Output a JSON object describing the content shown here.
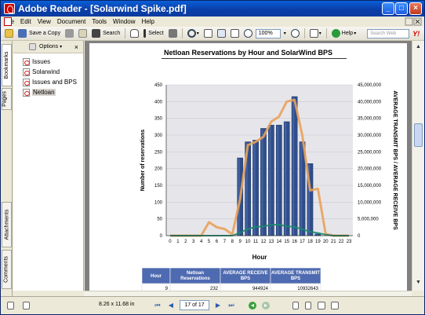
{
  "window": {
    "title": "Adobe Reader - [Solarwind Spike.pdf]",
    "controls": {
      "minimize": "_",
      "maximize": "□",
      "close": "×"
    },
    "accent": "#0a3fa8"
  },
  "menu": {
    "items": [
      "File",
      "Edit",
      "View",
      "Document",
      "Tools",
      "Window",
      "Help"
    ]
  },
  "toolbar": {
    "save_copy": "Save a Copy",
    "search": "Search",
    "select": "Select",
    "zoom": "100%",
    "help": "Help",
    "search_web_placeholder": "Search Web",
    "yahoo": "Y!"
  },
  "side_tabs": [
    "Bookmarks",
    "Pages",
    "Attachments",
    "Comments"
  ],
  "bookmarks": {
    "options_label": "Options",
    "items": [
      {
        "label": "Issues"
      },
      {
        "label": "Solarwind"
      },
      {
        "label": "Issues and BPS"
      },
      {
        "label": "Netloan"
      }
    ],
    "selected": "Netloan"
  },
  "status": {
    "page_size": "8.26 x 11.68 in",
    "page_indicator": "17 of 17"
  },
  "chart_data": {
    "type": "bar",
    "title": "Netloan Reservations by Hour and SolarWind BPS",
    "xlabel": "Hour",
    "ylabel": "Number of reservations",
    "y2label": "AVERAGE TRANSMIT BPS / AVERAGE RECEIVE BPS",
    "categories": [
      "0",
      "1",
      "2",
      "3",
      "4",
      "5",
      "6",
      "7",
      "8",
      "9",
      "10",
      "11",
      "12",
      "13",
      "14",
      "15",
      "16",
      "17",
      "18",
      "19",
      "20",
      "21",
      "22",
      "23"
    ],
    "ylim": [
      0,
      450
    ],
    "y_ticks": [
      "0",
      "50",
      "100",
      "150",
      "200",
      "250",
      "300",
      "350",
      "400",
      "450"
    ],
    "y2lim": [
      0,
      45000000
    ],
    "y2_ticks": [
      "0",
      "5,000,000",
      "10,000,000",
      "15,000,000",
      "20,000,000",
      "25,000,000",
      "30,000,000",
      "35,000,000",
      "40,000,000",
      "45,000,000"
    ],
    "series": [
      {
        "values": [
          0,
          0,
          0,
          0,
          0,
          0,
          0,
          0,
          0,
          232,
          280,
          285,
          320,
          330,
          330,
          340,
          415,
          280,
          215,
          5,
          0,
          0,
          0,
          0
        ]
      },
      {
        "values": [
          0,
          0,
          0,
          0,
          0,
          4000000,
          2500000,
          2000000,
          400000,
          10932643,
          27000000,
          28000000,
          29500000,
          34000000,
          35500000,
          40000000,
          40500000,
          30000000,
          13500000,
          14000000,
          500000,
          0,
          0,
          0
        ]
      },
      {
        "values": [
          0,
          0,
          0,
          0,
          0,
          0,
          0,
          0,
          0,
          944924,
          2000000,
          2600000,
          2800000,
          3200000,
          3300000,
          2800000,
          2600000,
          1900000,
          1200000,
          800000,
          300000,
          0,
          0,
          0
        ]
      }
    ],
    "colors": {
      "bars": "#2f4e8a",
      "transmit": "#e8a25c",
      "receive": "#1a8a6a",
      "plot_bg": "#e6e6ea"
    },
    "grid": true
  },
  "table": {
    "headers": [
      "Hour",
      "Netloan Reservations",
      "AVERAGE RECEIVE BPS",
      "AVERAGE TRANSMIT BPS"
    ],
    "rows": [
      [
        "9",
        "232",
        "944924",
        "10932643"
      ]
    ]
  }
}
